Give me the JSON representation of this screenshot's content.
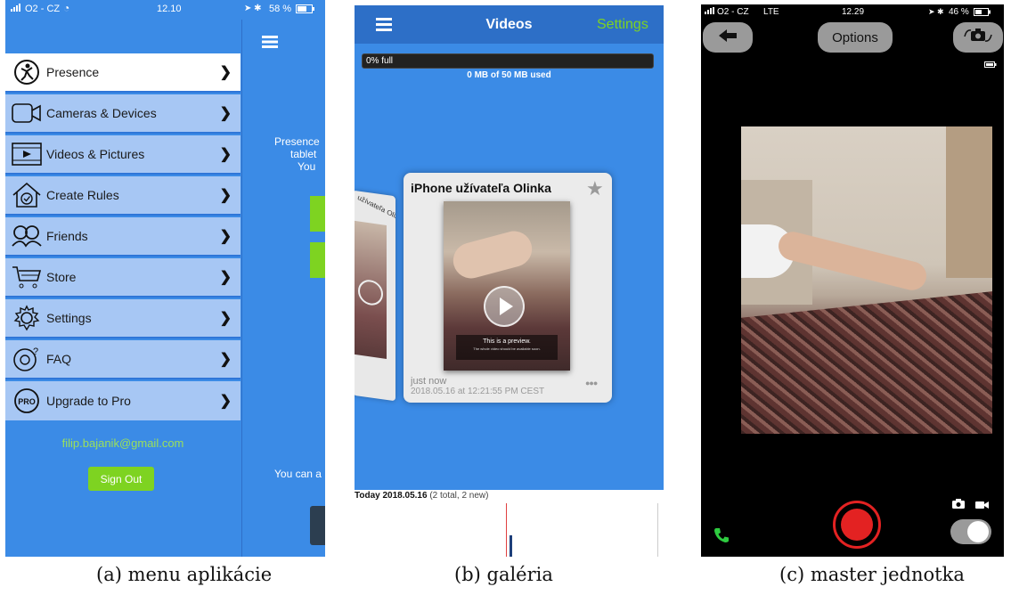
{
  "panel_a": {
    "status": {
      "carrier": "O2 - CZ",
      "time": "12.10",
      "battery": "58 %"
    },
    "menu": [
      {
        "label": "Presence",
        "icon": "presence-icon"
      },
      {
        "label": "Cameras & Devices",
        "icon": "camera-icon"
      },
      {
        "label": "Videos & Pictures",
        "icon": "video-film-icon"
      },
      {
        "label": "Create Rules",
        "icon": "house-check-icon"
      },
      {
        "label": "Friends",
        "icon": "friends-icon"
      },
      {
        "label": "Store",
        "icon": "cart-icon"
      },
      {
        "label": "Settings",
        "icon": "gear-icon"
      },
      {
        "label": "FAQ",
        "icon": "faq-icon"
      },
      {
        "label": "Upgrade to Pro",
        "icon": "pro-icon"
      }
    ],
    "email": "filip.bajanik@gmail.com",
    "sign_out": "Sign Out",
    "right_text_1": "Presence",
    "right_text_2": "tablet",
    "right_text_3": "You",
    "right_text_4": "You can a",
    "caption": "(a) menu aplikácie",
    "colors": {
      "accent": "#3b8be6",
      "menu_bg": "#a7c7f4",
      "green": "#7ed321"
    }
  },
  "panel_b": {
    "header": {
      "title": "Videos",
      "settings": "Settings"
    },
    "storage": {
      "label": "0% full",
      "used": "0 MB of 50 MB used",
      "progress": 0
    },
    "card": {
      "title": "iPhone užívateľa Olinka",
      "preview_line_1": "This is a preview.",
      "preview_line_2": "The whole video should be available soon.",
      "when": "just now",
      "timestamp": "2018.05.16 at 12:21:55 PM CEST",
      "side_label": "užívateľa Olinka"
    },
    "timeline": {
      "date": "Today 2018.05.16",
      "summary": "(2 total, 2 new)"
    },
    "caption": "(b) galéria"
  },
  "panel_c": {
    "status": {
      "carrier": "O2 - CZ",
      "network": "LTE",
      "time": "12.29",
      "battery": "46 %"
    },
    "options": "Options",
    "record_state": "idle",
    "toggle_on": true,
    "caption": "(c) master jednotka",
    "colors": {
      "record": "#e32222",
      "call": "#2ecc40"
    }
  }
}
